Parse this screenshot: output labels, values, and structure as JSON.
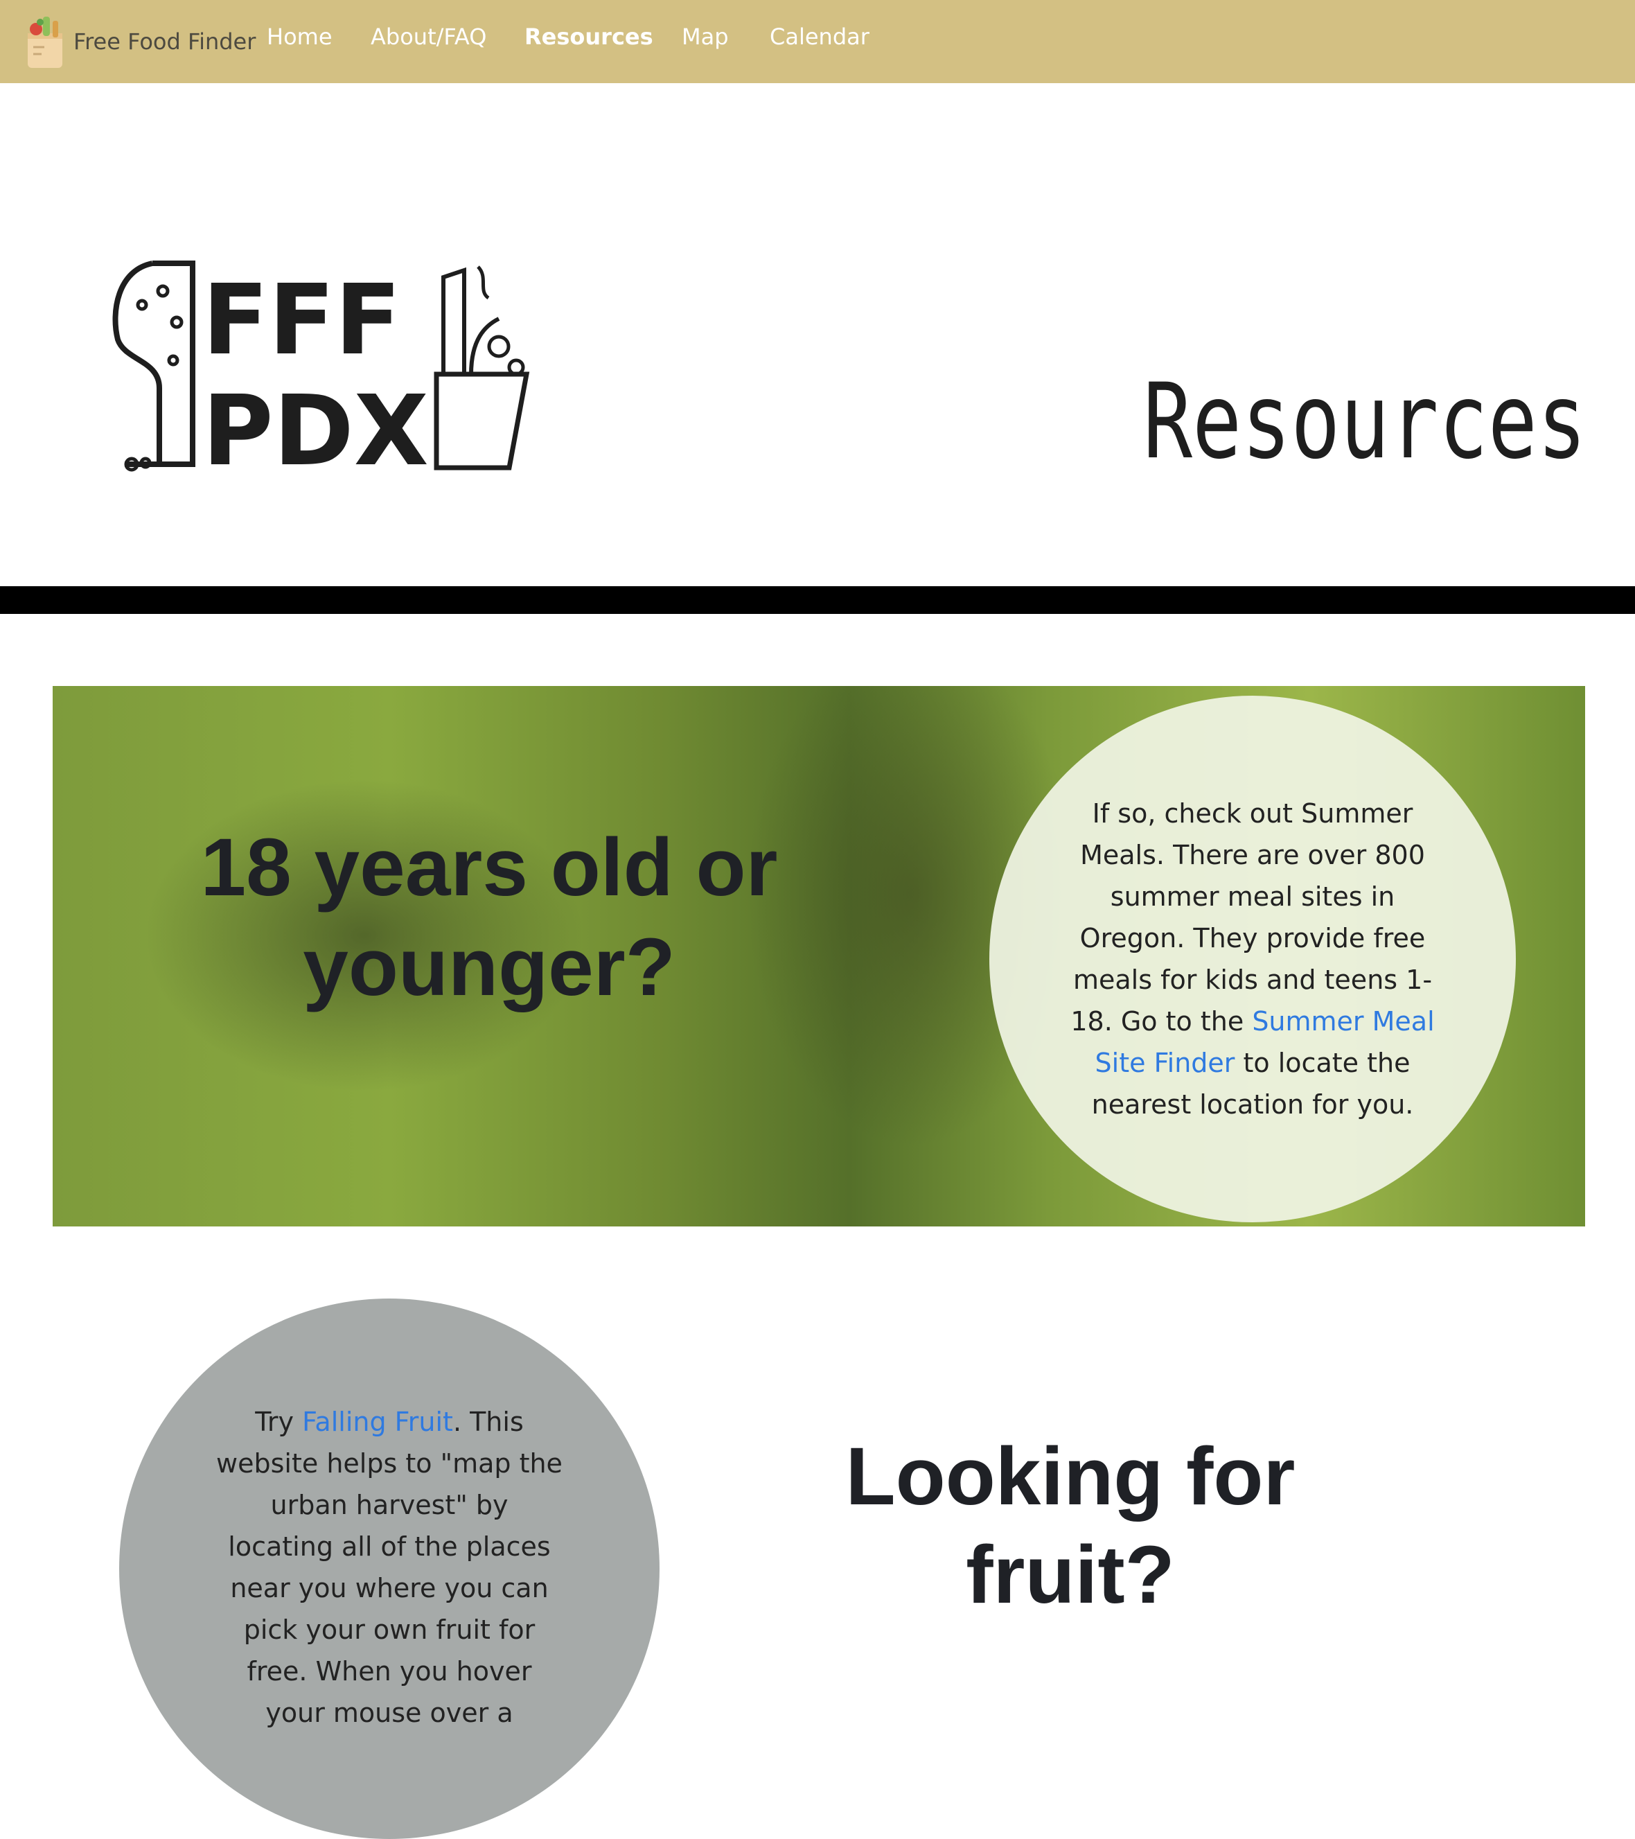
{
  "nav": {
    "brand": "Free Food Finder",
    "links": [
      "Home",
      "About/FAQ",
      "Resources",
      "Map",
      "Calendar"
    ]
  },
  "hero": {
    "logo_lines": [
      "FFF",
      "PDX"
    ],
    "title": "Resources"
  },
  "section_kids": {
    "question": "18 years old or younger?",
    "text_before": "If so, check out Summer Meals. There are over 800 summer meal sites in Oregon. They provide free meals for kids and teens 1-18. Go to the ",
    "link": "Summer Meal Site Finder",
    "text_after": " to locate the nearest location for you."
  },
  "section_fruit": {
    "question": "Looking for fruit?",
    "text_before": "Try ",
    "link": "Falling Fruit",
    "text_after": ". This website helps to \"map the urban harvest\" by locating all of the places near you where you can pick your own fruit for free. When you hover your mouse over a"
  },
  "colors": {
    "navbar": "#d3c083",
    "link": "#2f7ae0",
    "heading": "#1f2126",
    "grey_circle": "#a6aaa9"
  }
}
